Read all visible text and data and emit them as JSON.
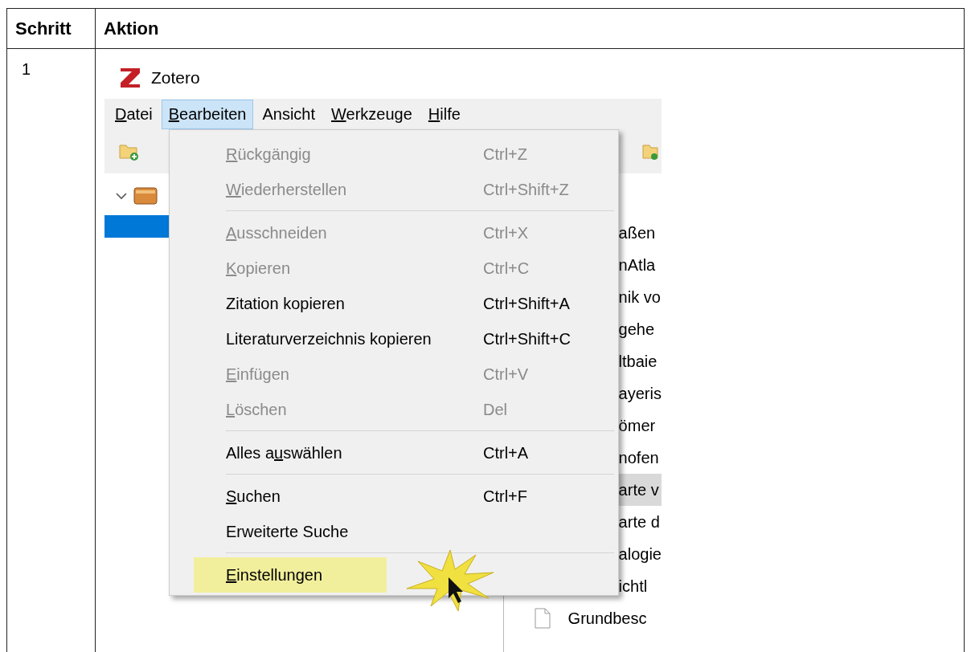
{
  "table": {
    "columns": [
      "Schritt",
      "Aktion"
    ],
    "rows": [
      {
        "step": "1",
        "app": {
          "title": "Zotero",
          "menubar": [
            {
              "key": "D",
              "post": "atei",
              "selected": false
            },
            {
              "key": "B",
              "post": "earbeiten",
              "selected": true
            },
            {
              "pre": "Ansicht",
              "selected": false
            },
            {
              "key": "W",
              "post": "erkzeuge",
              "selected": false
            },
            {
              "key": "H",
              "post": "ilfe",
              "selected": false
            }
          ],
          "menu": [
            {
              "kind": "item",
              "key": "R",
              "post": "ückgängig",
              "shortcut": "Ctrl+Z",
              "disabled": true,
              "highlighted": false
            },
            {
              "kind": "item",
              "key": "W",
              "post": "iederherstellen",
              "shortcut": "Ctrl+Shift+Z",
              "disabled": true,
              "highlighted": false
            },
            {
              "kind": "separator"
            },
            {
              "kind": "item",
              "key": "A",
              "post": "usschneiden",
              "shortcut": "Ctrl+X",
              "disabled": true,
              "highlighted": false
            },
            {
              "kind": "item",
              "key": "K",
              "post": "opieren",
              "shortcut": "Ctrl+C",
              "disabled": true,
              "highlighted": false
            },
            {
              "kind": "item",
              "pre": "Zitation kopieren",
              "shortcut": "Ctrl+Shift+A",
              "disabled": false,
              "highlighted": false
            },
            {
              "kind": "item",
              "pre": "Literaturverzeichnis kopieren",
              "shortcut": "Ctrl+Shift+C",
              "disabled": false,
              "highlighted": false
            },
            {
              "kind": "item",
              "key": "E",
              "post": "infügen",
              "shortcut": "Ctrl+V",
              "disabled": true,
              "highlighted": false
            },
            {
              "kind": "item",
              "key": "L",
              "post": "öschen",
              "shortcut": "Del",
              "disabled": true,
              "highlighted": false
            },
            {
              "kind": "separator"
            },
            {
              "kind": "item",
              "pre": "Alles a",
              "key": "u",
              "post": "swählen",
              "shortcut": "Ctrl+A",
              "disabled": false,
              "highlighted": false
            },
            {
              "kind": "separator"
            },
            {
              "kind": "item",
              "key": "S",
              "post": "uchen",
              "shortcut": "Ctrl+F",
              "disabled": false,
              "highlighted": false
            },
            {
              "kind": "item",
              "pre": "Erweiterte Suche",
              "disabled": false,
              "highlighted": false
            },
            {
              "kind": "separator"
            },
            {
              "kind": "item",
              "key": "E",
              "post": "instellungen",
              "disabled": false,
              "highlighted": true
            }
          ],
          "items": [
            {
              "kind": "cut",
              "text": "aßen",
              "selected": false
            },
            {
              "kind": "cut",
              "text": "nAtla",
              "selected": false
            },
            {
              "kind": "cut",
              "text": "nik vo",
              "selected": false
            },
            {
              "kind": "cut",
              "text": "gehe",
              "selected": false
            },
            {
              "kind": "cut",
              "text": "ltbaie",
              "selected": false
            },
            {
              "kind": "cut",
              "text": "ayeris",
              "selected": false
            },
            {
              "kind": "cut",
              "text": "ömer",
              "selected": false
            },
            {
              "kind": "cut",
              "text": "nofen",
              "selected": false
            },
            {
              "kind": "cut",
              "text": "arte v",
              "selected": true
            },
            {
              "kind": "cut",
              "text": "arte d",
              "selected": false
            },
            {
              "kind": "cut",
              "text": "alogie",
              "selected": false
            },
            {
              "kind": "cut",
              "text": "ichtl",
              "selected": false
            },
            {
              "kind": "document",
              "text": "Grundbesc",
              "selected": false
            }
          ]
        }
      }
    ]
  }
}
